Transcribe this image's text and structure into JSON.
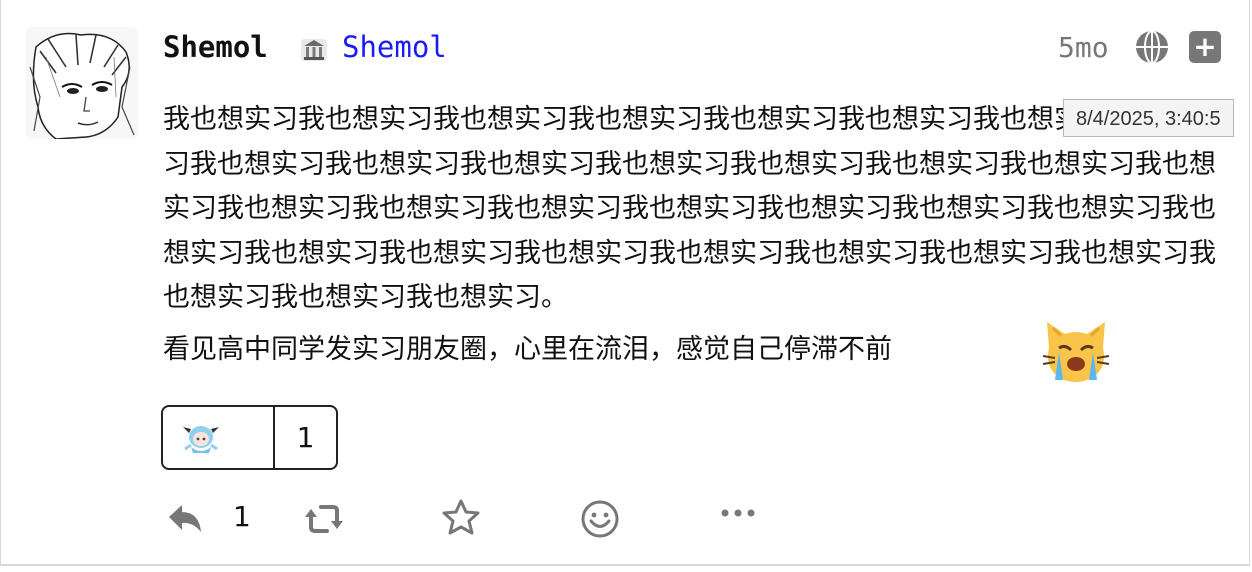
{
  "author": {
    "display_name": "Shemol",
    "instance_name": "Shemol"
  },
  "meta": {
    "relative_time": "5mo",
    "tooltip": "8/4/2025, 3:40:5"
  },
  "post": {
    "paragraph1": "我也想实习我也想实习我也想实习我也想实习我也想实习我也想实习我也想实习我也想实习我也想实习我也想实习我也想实习我也想实习我也想实习我也想实习我也想实习我也想实习我也想实习我也想实习我也想实习我也想实习我也想实习我也想实习我也想实习我也想实习我也想实习我也想实习我也想实习我也想实习我也想实习我也想实习我也想实习我也想实习我也想实习我也想实习。",
    "paragraph2": "看见高中同学发实习朋友圈，心里在流泪，感觉自己停滞不前"
  },
  "reaction": {
    "count": "1"
  },
  "actions": {
    "reply_count": "1",
    "icons": [
      "reply-icon",
      "boost-icon",
      "star-icon",
      "emoji-react-icon",
      "more-icon"
    ]
  },
  "colors": {
    "handle": "#1a1aff",
    "muted": "#777777"
  }
}
